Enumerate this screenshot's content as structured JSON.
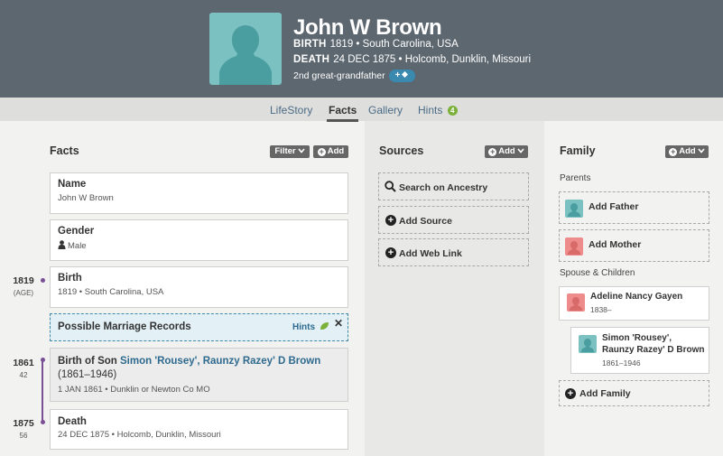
{
  "person": {
    "name": "John W Brown",
    "birth_label": "BIRTH",
    "birth_value": "1819 • South Carolina, USA",
    "death_label": "DEATH",
    "death_value": "24 DEC 1875 • Holcomb, Dunklin, Missouri",
    "relationship": "2nd great-grandfather",
    "relationship_button": "+"
  },
  "tabs": [
    {
      "label": "LifeStory"
    },
    {
      "label": "Facts"
    },
    {
      "label": "Gallery"
    },
    {
      "label": "Hints",
      "badge": "4"
    }
  ],
  "facts": {
    "title": "Facts",
    "filter_label": "Filter",
    "add_label": "Add",
    "name_card": {
      "title": "Name",
      "value": "John W Brown"
    },
    "gender_card": {
      "title": "Gender",
      "value": "Male"
    },
    "birth_card": {
      "title": "Birth",
      "value": "1819 • South Carolina, USA",
      "year": "1819",
      "age": "(AGE)"
    },
    "hint_card": {
      "title": "Possible Marriage Records",
      "hints_label": "Hints",
      "close": "✕"
    },
    "son_card": {
      "title_prefix": "Birth of Son",
      "son_name": "Simon 'Rousey', Raunzy Razey' D Brown",
      "dates": "(1861–1946)",
      "value": "1 JAN 1861 • Dunklin or Newton Co MO",
      "year": "1861",
      "age": "42"
    },
    "death_card": {
      "title": "Death",
      "value": "24 DEC 1875 • Holcomb, Dunklin, Missouri",
      "year": "1875",
      "age": "56"
    }
  },
  "sources": {
    "title": "Sources",
    "add_label": "Add",
    "search": "Search on Ancestry",
    "add_source": "Add Source",
    "add_web_link": "Add Web Link"
  },
  "family": {
    "title": "Family",
    "add_label": "Add",
    "parents_label": "Parents",
    "add_father": "Add Father",
    "add_mother": "Add Mother",
    "spouse_label": "Spouse & Children",
    "spouse": {
      "name": "Adeline Nancy Gayen",
      "dates": "1838–"
    },
    "child": {
      "name_line1": "Simon 'Rousey',",
      "name_line2": "Raunzy Razey' D Brown",
      "dates": "1861–1946"
    },
    "add_family": "Add Family"
  },
  "colors": {
    "header": "#5d6770",
    "male": "#7cc1c2",
    "female": "#ee8b8b",
    "timeline": "#7a4f93",
    "link": "#2e6a8e",
    "hints": "#7bb03a"
  }
}
